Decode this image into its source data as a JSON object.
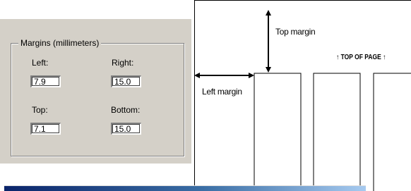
{
  "margins_group": {
    "legend": "Margins (millimeters)",
    "left_label": "Left:",
    "left_value": "7.9",
    "right_label": "Right:",
    "right_value": "15.0",
    "top_label": "Top:",
    "top_value": "7.1",
    "bottom_label": "Bottom:",
    "bottom_value": "15.0"
  },
  "diagram": {
    "top_margin_label": "Top margin",
    "left_margin_label": "Left margin",
    "top_of_page_label": "↑ TOP OF PAGE ↑"
  },
  "colors": {
    "dialog_face": "#d4d0c8",
    "titlebar_start": "#0a246a",
    "titlebar_end": "#a6caf0"
  }
}
